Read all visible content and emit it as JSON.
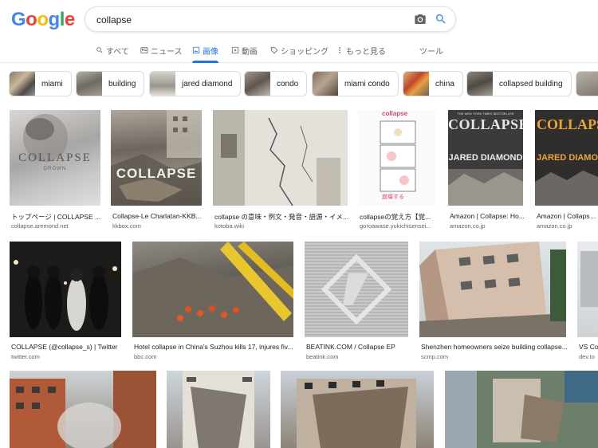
{
  "logo": {
    "letters": [
      "G",
      "o",
      "o",
      "g",
      "l",
      "e"
    ],
    "colors": [
      "#4285f4",
      "#ea4335",
      "#fbbc05",
      "#4285f4",
      "#34a853",
      "#ea4335"
    ]
  },
  "search": {
    "query": "collapse"
  },
  "tabs": [
    {
      "label": "すべて",
      "icon": "search-icon"
    },
    {
      "label": "ニュース",
      "icon": "news-icon"
    },
    {
      "label": "画像",
      "icon": "image-icon",
      "active": true
    },
    {
      "label": "動画",
      "icon": "video-icon"
    },
    {
      "label": "ショッピング",
      "icon": "tag-icon"
    },
    {
      "label": "もっと見る",
      "icon": "more-vert-icon"
    },
    {
      "label": "ツール",
      "icon": ""
    }
  ],
  "chips": [
    "miami",
    "building",
    "jared diamond",
    "condo",
    "miami condo",
    "china",
    "collapsed building"
  ],
  "results": [
    {
      "title": "トップページ | COLLAPSE ...",
      "source": "collapse.aremond.net",
      "img_text": "COLLAPSE",
      "img_sub": "DROWN"
    },
    {
      "title": "Collapse-Le Charlatan-KKB...",
      "source": "kkbox.com",
      "img_text": "COLLAPSE"
    },
    {
      "title": "collapse の意味・例文・発音・語源・イメ...",
      "source": "kotoba.wiki"
    },
    {
      "title": "collapseの覚え方【覚...",
      "source": "goroawase.yukichisensei...",
      "img_text": "collapse",
      "img_sub": "崩壊する"
    },
    {
      "title": "Amazon | Collapse: Ho...",
      "source": "amazon.co.jp",
      "img_text": "COLLAPSE",
      "img_sub": "JARED DIAMOND",
      "img_top": "THE NEW YORK TIMES BESTSELLER"
    },
    {
      "title": "Amazon | Collapse | Di...",
      "source": "amazon.co.jp",
      "img_text": "COLLAPSE",
      "img_sub": "JARED DIAMOND"
    },
    {
      "title": "COLLAPSE (@collapse_s) | Twitter",
      "source": "twitter.com"
    },
    {
      "title": "Hotel collapse in China's Suzhou kills 17, injures fiv...",
      "source": "bbc.com"
    },
    {
      "title": "BEATINK.COM / Collapse EP",
      "source": "beatink.com"
    },
    {
      "title": "Shenzhen homeowners seize building collapse...",
      "source": "scmp.com"
    },
    {
      "title": "VS Co...",
      "source": "dev.to"
    }
  ]
}
